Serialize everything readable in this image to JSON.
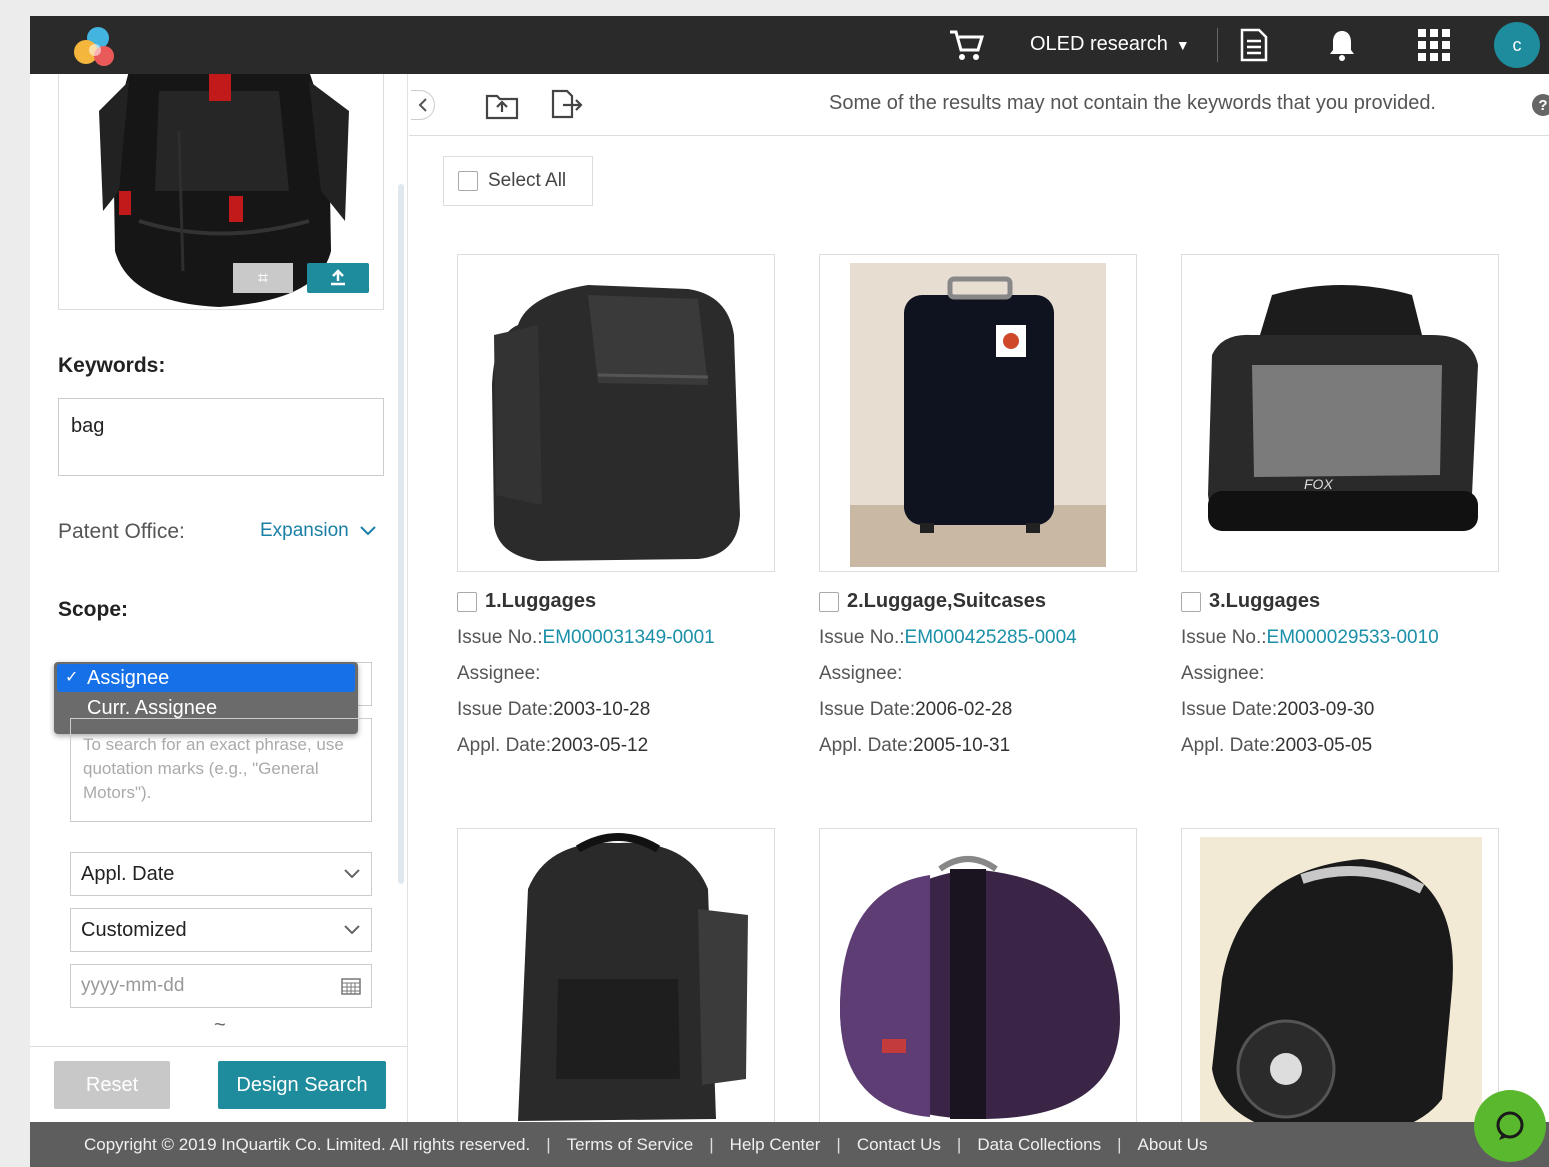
{
  "topbar": {
    "project_label": "OLED research",
    "avatar_letter": "c",
    "icons": [
      "logo-icon",
      "cart-icon",
      "chevron-down-icon",
      "document-icon",
      "bell-icon",
      "apps-grid-icon"
    ]
  },
  "left_panel": {
    "keywords_label": "Keywords:",
    "keywords_value": "bag",
    "patent_office_label": "Patent Office:",
    "expansion_label": "Expansion",
    "scope_label": "Scope:",
    "scope_options": [
      "Assignee",
      "Curr. Assignee"
    ],
    "scope_selected": "Assignee",
    "phrase_placeholder": "To search for an exact phrase, use quotation marks (e.g., \"General Motors\").",
    "date_type": "Appl. Date",
    "date_range": "Customized",
    "date_placeholder": "yyyy-mm-dd",
    "range_separator": "~",
    "reset_label": "Reset",
    "search_label": "Design Search"
  },
  "toolbar": {
    "notice": "Some of the results may not contain the keywords that you provided.",
    "help": "?"
  },
  "results": {
    "select_all_label": "Select All",
    "issue_no_label": "Issue No.:",
    "assignee_label": "Assignee:",
    "issue_date_label": "Issue Date:",
    "appl_date_label": "Appl. Date:",
    "items": [
      {
        "title": "1.Luggages",
        "issue_no": "EM000031349-0001",
        "assignee": "",
        "issue_date": "2003-10-28",
        "appl_date": "2003-05-12"
      },
      {
        "title": "2.Luggage,Suitcases",
        "issue_no": "EM000425285-0004",
        "assignee": "",
        "issue_date": "2006-02-28",
        "appl_date": "2005-10-31"
      },
      {
        "title": "3.Luggages",
        "issue_no": "EM000029533-0010",
        "assignee": "",
        "issue_date": "2003-09-30",
        "appl_date": "2003-05-05"
      }
    ]
  },
  "footer": {
    "copyright": "Copyright © 2019 InQuartik Co. Limited. All rights reserved.",
    "links": [
      "Terms of Service",
      "Help Center",
      "Contact Us",
      "Data Collections",
      "About Us"
    ]
  },
  "colors": {
    "topbar": "#2a2a2a",
    "accent": "#1e8c9c",
    "link": "#1a8fa8",
    "footer": "#5e5e5e",
    "chat": "#5ab82e",
    "dropdown_selected": "#1671e8"
  }
}
